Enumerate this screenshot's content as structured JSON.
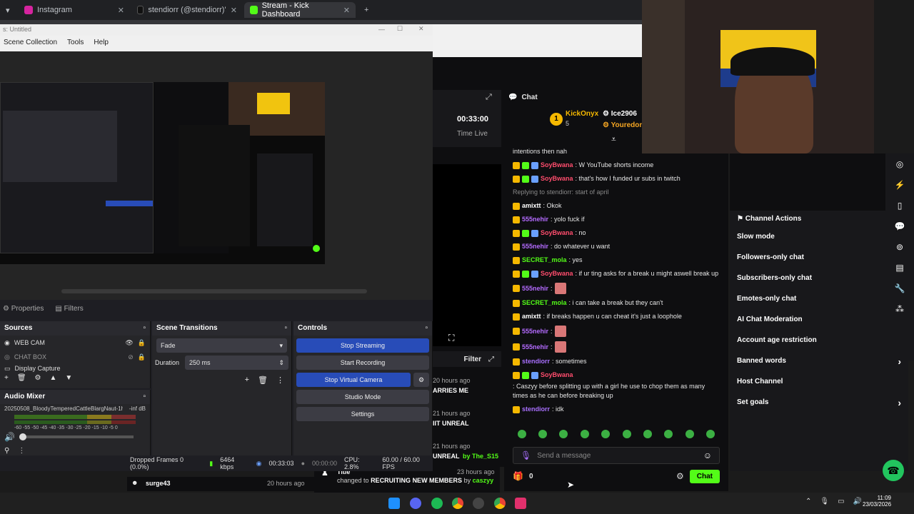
{
  "browser": {
    "tabs": [
      {
        "label": "Instagram",
        "color": "#d6249f"
      },
      {
        "label": "stendiorr (@stendiorr)'s videos",
        "color": "#111111"
      },
      {
        "label": "Stream - Kick Dashboard",
        "color": "#53fc18"
      }
    ],
    "new_tab": "+"
  },
  "obs": {
    "title": "s: Untitled",
    "menu": [
      "Scene Collection",
      "Tools",
      "Help"
    ],
    "properties": "Properties",
    "filters": "Filters",
    "sources": {
      "header": "Sources",
      "items": [
        "WEB CAM",
        "CHAT BOX",
        "Display Capture"
      ]
    },
    "transitions": {
      "header": "Scene Transitions",
      "type": "Fade",
      "duration_label": "Duration",
      "duration": "250 ms"
    },
    "controls": {
      "header": "Controls",
      "stop_streaming": "Stop Streaming",
      "start_recording": "Start Recording",
      "stop_virtual_camera": "Stop Virtual Camera",
      "studio_mode": "Studio Mode",
      "settings": "Settings"
    },
    "mixer": {
      "header": "Audio Mixer",
      "track": "20250508_BloodyTemperedCattleBlargNaut-1hz",
      "level": "-inf dB",
      "scale": "-60 -55 -50 -45 -40 -35 -30 -25 -20 -15 -10 -5 0"
    },
    "status": {
      "dropped": "Dropped Frames 0 (0.0%)",
      "kbps": "6464 kbps",
      "stream_time": "00:33:03",
      "rec_time": "00:00:00",
      "cpu": "CPU: 2.8%",
      "fps": "60.00 / 60.00 FPS"
    }
  },
  "kick": {
    "time_value": "00:33:00",
    "time_label": "Time Live",
    "filter": "Filter",
    "chat_title": "Chat",
    "leaderboard": [
      {
        "name": "KickOnyx",
        "count": "5",
        "rank": "1"
      },
      {
        "name": "Ice2906",
        "count": ""
      },
      {
        "name": "Youredon",
        "count": ""
      }
    ],
    "messages": [
      {
        "user": "",
        "text": "intentions then nah",
        "color": "#e6e6e6"
      },
      {
        "user": "SoyBwana",
        "text": ": W YouTube shorts income",
        "color": "#ff4d6d"
      },
      {
        "user": "SoyBwana",
        "text": ": that's how I funded ur subs in twitch",
        "color": "#ff4d6d"
      },
      {
        "user": "",
        "text": "Replying to stendiorr: start of april",
        "color": "#888888"
      },
      {
        "user": "amixtt",
        "text": ": Okok",
        "color": "#ffffff"
      },
      {
        "user": "555nehir",
        "text": ": yolo fuck if",
        "color": "#b46bff"
      },
      {
        "user": "SoyBwana",
        "text": ": no",
        "color": "#ff4d6d"
      },
      {
        "user": "555nehir",
        "text": ": do whatever u want",
        "color": "#b46bff"
      },
      {
        "user": "SECRET_mola",
        "text": ": yes",
        "color": "#53fc18"
      },
      {
        "user": "SoyBwana",
        "text": ": if ur ting asks for a break u might aswell break up",
        "color": "#ff4d6d"
      },
      {
        "user": "555nehir",
        "text": ":",
        "color": "#b46bff"
      },
      {
        "user": "SECRET_mola",
        "text": ": i can take a break but they can't",
        "color": "#53fc18"
      },
      {
        "user": "amixtt",
        "text": ": if breaks happen u can cheat it's just a loophole",
        "color": "#ffffff"
      },
      {
        "user": "555nehir",
        "text": ":",
        "color": "#b46bff"
      },
      {
        "user": "555nehir",
        "text": ":",
        "color": "#b46bff"
      },
      {
        "user": "stendiorr",
        "text": ": sometimes",
        "color": "#a970ff"
      },
      {
        "user": "SoyBwana",
        "text": ": Caszyy before splitting up with a girl he use to chop them as many times as he can before breaking up",
        "color": "#ff4d6d"
      },
      {
        "user": "stendiorr",
        "text": ": idk",
        "color": "#a970ff"
      }
    ],
    "input_placeholder": "Send a message",
    "viewer_count": "0",
    "chat_button": "Chat",
    "channel_actions": {
      "title": "Channel Actions",
      "items": [
        {
          "label": "Slow mode",
          "kind": "arrow"
        },
        {
          "label": "Followers-only chat",
          "kind": "arrow"
        },
        {
          "label": "Subscribers-only chat",
          "kind": "toggle"
        },
        {
          "label": "Emotes-only chat",
          "kind": "toggle"
        },
        {
          "label": "AI Chat Moderation",
          "kind": "link"
        },
        {
          "label": "Account age restriction",
          "kind": "arrow"
        },
        {
          "label": "Banned words",
          "kind": "arrow"
        },
        {
          "label": "Host Channel",
          "kind": "none"
        },
        {
          "label": "Set goals",
          "kind": "arrow"
        }
      ]
    },
    "feed": [
      {
        "time": "20 hours ago",
        "title": "ARRIES ME",
        "by": "by"
      },
      {
        "time": "21 hours ago",
        "title": "IIT UNREAL",
        "by": "by"
      },
      {
        "time": "21 hours ago",
        "title": "UNREAL",
        "by": "by The_S15"
      },
      {
        "time": "23 hours ago",
        "title": "Title",
        "sub": "changed to RECRUITING NEW MEMBERS by caszyy"
      },
      {
        "time": "20 hours ago",
        "title": "surge43",
        "by": ""
      }
    ],
    "feed_changed_prefix": "changed to",
    "feed_changed_value": "RECRUITING NEW MEMBERS",
    "feed_changed_by": "by",
    "feed_changed_user": "caszyy"
  },
  "taskbar": {
    "time": "11:09",
    "date": "23/03/2026"
  }
}
